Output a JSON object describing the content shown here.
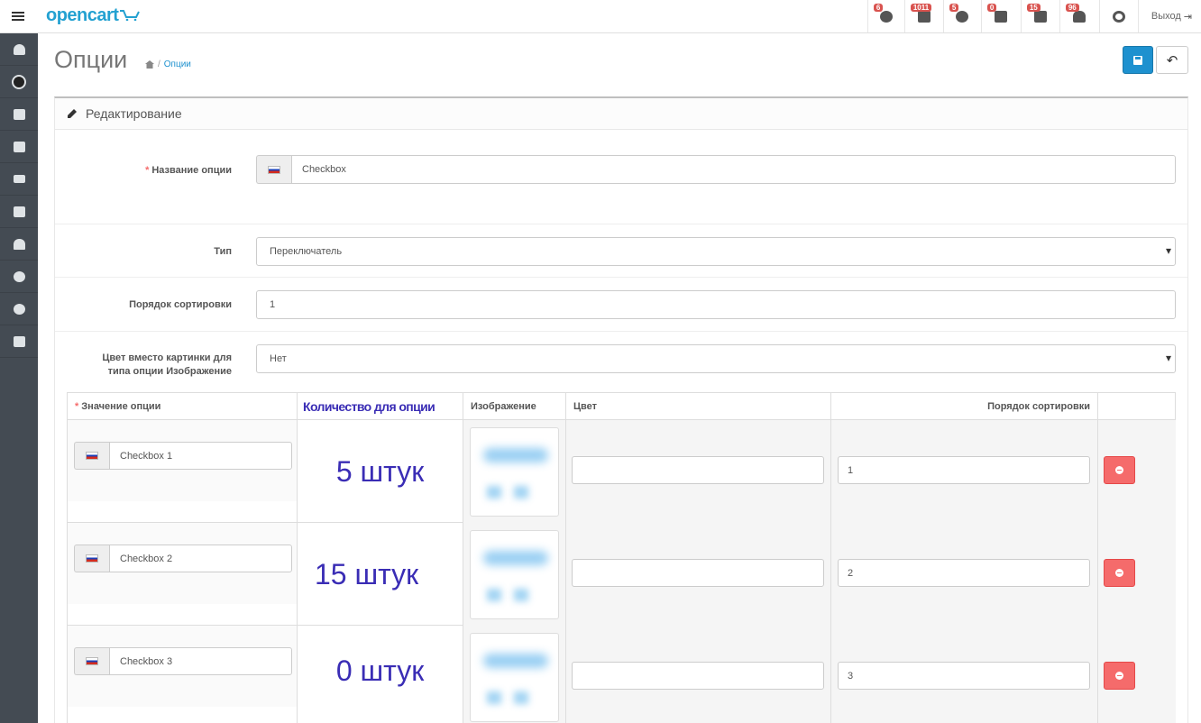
{
  "header": {
    "logo": "opencart",
    "logout_label": "Выход",
    "badges": [
      "6",
      "1011",
      "5",
      "0",
      "15",
      "96"
    ]
  },
  "sidebar": {
    "items": [
      "dashboard-icon",
      "puzzle-logo-icon",
      "tags-icon",
      "puzzle-icon",
      "desktop-icon",
      "cart-icon",
      "user-icon",
      "share-icon",
      "cog-icon",
      "chart-icon"
    ]
  },
  "page": {
    "title": "Опции",
    "breadcrumb": "Опции",
    "breadcrumb_sep": "/"
  },
  "panel": {
    "heading": "Редактирование",
    "option_name_label": "Название опции",
    "option_name_value": "Checkbox",
    "type_label": "Тип",
    "type_value": "Переключатель",
    "sort_label": "Порядок сортировки",
    "sort_value": "1",
    "color_label_1": "Цвет вместо картинки для",
    "color_label_2": "типа опции Изображение",
    "color_value": "Нет"
  },
  "values_table": {
    "headers": {
      "value": "Значение опции",
      "quantity": "Количество для опции",
      "image": "Изображение",
      "color": "Цвет",
      "sort": "Порядок сортировки"
    },
    "rows": [
      {
        "name": "Checkbox 1",
        "quantity": "5 штук",
        "color": "",
        "sort": "1"
      },
      {
        "name": "Checkbox 2",
        "quantity": "15 штук",
        "color": "",
        "sort": "2"
      },
      {
        "name": "Checkbox 3",
        "quantity": "0 штук",
        "color": "",
        "sort": "3"
      }
    ]
  },
  "colors": {
    "primary": "#1e91cf",
    "danger": "#f56b6b",
    "sidebar": "#444b53",
    "annotation": "#3a2db5"
  }
}
